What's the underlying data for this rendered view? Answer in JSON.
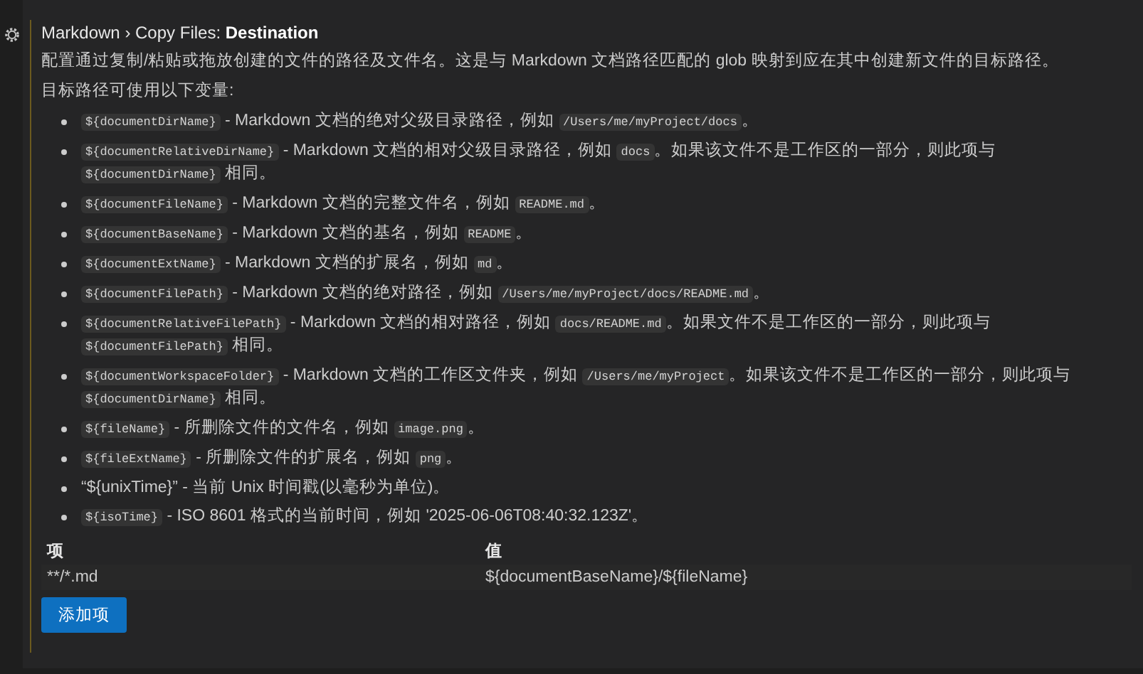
{
  "setting": {
    "breadcrumb": "Markdown › Copy Files: ",
    "title": "Destination",
    "description": "配置通过复制/粘贴或拖放创建的文件的路径及文件名。这是与 Markdown 文档路径匹配的 glob 映射到应在其中创建新文件的目标路径。",
    "variables_intro": "目标路径可使用以下变量:",
    "variables": [
      [
        {
          "kind": "code",
          "text": "${documentDirName}"
        },
        {
          "kind": "text",
          "text": " - Markdown 文档的绝对父级目录路径，例如 "
        },
        {
          "kind": "code",
          "text": "/Users/me/myProject/docs"
        },
        {
          "kind": "text",
          "text": "。"
        }
      ],
      [
        {
          "kind": "code",
          "text": "${documentRelativeDirName}"
        },
        {
          "kind": "text",
          "text": " - Markdown 文档的相对父级目录路径，例如 "
        },
        {
          "kind": "code",
          "text": "docs"
        },
        {
          "kind": "text",
          "text": "。如果该文件不是工作区的一部分，则此项与 "
        },
        {
          "kind": "code",
          "text": "${documentDirName}"
        },
        {
          "kind": "text",
          "text": " 相同。"
        }
      ],
      [
        {
          "kind": "code",
          "text": "${documentFileName}"
        },
        {
          "kind": "text",
          "text": " - Markdown 文档的完整文件名，例如 "
        },
        {
          "kind": "code",
          "text": "README.md"
        },
        {
          "kind": "text",
          "text": "。"
        }
      ],
      [
        {
          "kind": "code",
          "text": "${documentBaseName}"
        },
        {
          "kind": "text",
          "text": " - Markdown 文档的基名，例如 "
        },
        {
          "kind": "code",
          "text": "README"
        },
        {
          "kind": "text",
          "text": "。"
        }
      ],
      [
        {
          "kind": "code",
          "text": "${documentExtName}"
        },
        {
          "kind": "text",
          "text": " - Markdown 文档的扩展名，例如 "
        },
        {
          "kind": "code",
          "text": "md"
        },
        {
          "kind": "text",
          "text": "。"
        }
      ],
      [
        {
          "kind": "code",
          "text": "${documentFilePath}"
        },
        {
          "kind": "text",
          "text": " - Markdown 文档的绝对路径，例如 "
        },
        {
          "kind": "code",
          "text": "/Users/me/myProject/docs/README.md"
        },
        {
          "kind": "text",
          "text": "。"
        }
      ],
      [
        {
          "kind": "code",
          "text": "${documentRelativeFilePath}"
        },
        {
          "kind": "text",
          "text": " - Markdown 文档的相对路径，例如 "
        },
        {
          "kind": "code",
          "text": "docs/README.md"
        },
        {
          "kind": "text",
          "text": "。如果文件不是工作区的一部分，则此项与 "
        },
        {
          "kind": "code",
          "text": "${documentFilePath}"
        },
        {
          "kind": "text",
          "text": " 相同。"
        }
      ],
      [
        {
          "kind": "code",
          "text": "${documentWorkspaceFolder}"
        },
        {
          "kind": "text",
          "text": " - Markdown 文档的工作区文件夹，例如 "
        },
        {
          "kind": "code",
          "text": "/Users/me/myProject"
        },
        {
          "kind": "text",
          "text": "。如果该文件不是工作区的一部分，则此项与 "
        },
        {
          "kind": "code",
          "text": "${documentDirName}"
        },
        {
          "kind": "text",
          "text": " 相同。"
        }
      ],
      [
        {
          "kind": "code",
          "text": "${fileName}"
        },
        {
          "kind": "text",
          "text": " - 所删除文件的文件名，例如 "
        },
        {
          "kind": "code",
          "text": "image.png"
        },
        {
          "kind": "text",
          "text": "。"
        }
      ],
      [
        {
          "kind": "code",
          "text": "${fileExtName}"
        },
        {
          "kind": "text",
          "text": " - 所删除文件的扩展名，例如 "
        },
        {
          "kind": "code",
          "text": "png"
        },
        {
          "kind": "text",
          "text": "。"
        }
      ],
      [
        {
          "kind": "text",
          "text": "“${unixTime}” - 当前 Unix 时间戳(以毫秒为单位)。"
        }
      ],
      [
        {
          "kind": "code",
          "text": "${isoTime}"
        },
        {
          "kind": "text",
          "text": " - ISO 8601 格式的当前时间，例如 '2025-06-06T08:40:32.123Z'。"
        }
      ]
    ],
    "table": {
      "columns": [
        "项",
        "值"
      ],
      "rows": [
        [
          "**/*.md",
          "${documentBaseName}/${fileName}"
        ]
      ]
    },
    "add_button": "添加项"
  }
}
